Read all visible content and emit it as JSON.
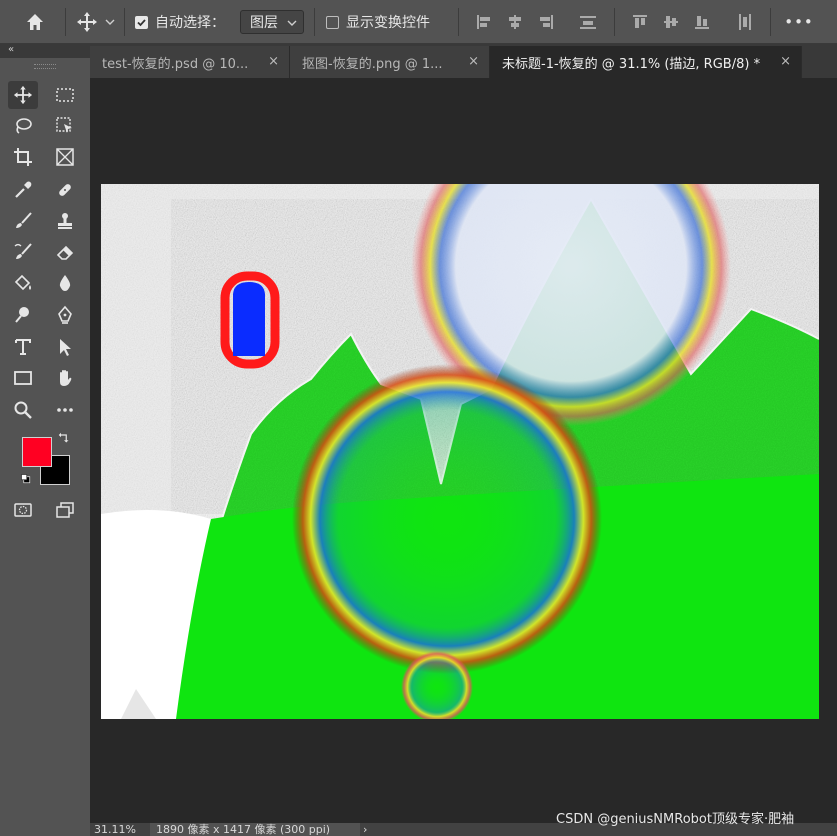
{
  "options_bar": {
    "auto_select_label": "自动选择：",
    "auto_select_target": "图层",
    "show_transform_label": "显示变换控件",
    "more_label": "•••"
  },
  "panel_collapse": "«",
  "tabs": [
    {
      "label": "test-恢复的.psd @ 10...",
      "close": "×"
    },
    {
      "label": "抠图-恢复的.png @ 1...",
      "close": "×"
    },
    {
      "label": "未标题-1-恢复的 @ 31.1% (描边, RGB/8) *",
      "close": "×"
    }
  ],
  "status": {
    "zoom": "31.11%",
    "doc_info": "1890 像素 x 1417 像素 (300 ppi)",
    "arrow": "›"
  },
  "colors": {
    "foreground": "#ff0022",
    "background": "#000000"
  },
  "watermark": "CSDN @geniusNMRobot顶级专家·肥袖"
}
